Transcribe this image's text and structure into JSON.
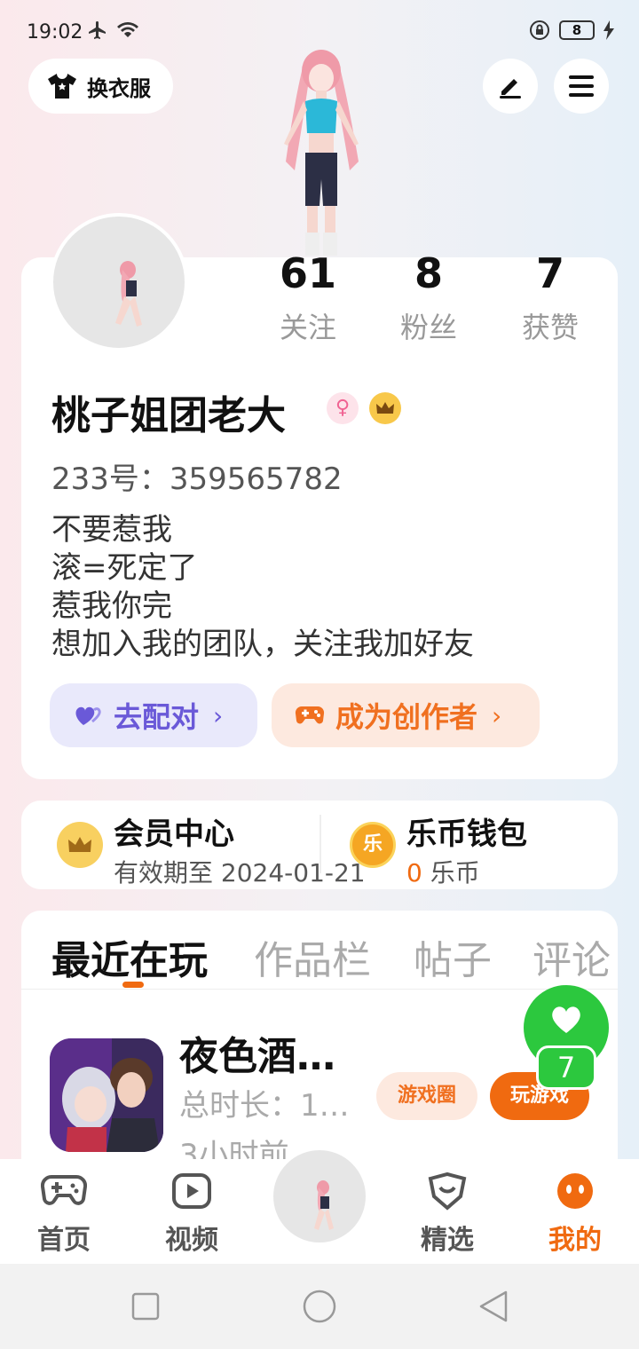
{
  "status_bar": {
    "time": "19:02",
    "battery": "8"
  },
  "header": {
    "outfit_label": "换衣服"
  },
  "stats": [
    {
      "value": "61",
      "label": "关注"
    },
    {
      "value": "8",
      "label": "粉丝"
    },
    {
      "value": "7",
      "label": "获赞"
    }
  ],
  "profile": {
    "name": "桃子姐团老大",
    "uid": "233号：359565782",
    "bio": [
      "不要惹我",
      "滚=死定了",
      "惹我你完",
      "想加入我的团队，关注我加好友"
    ],
    "match_label": "去配对",
    "creator_label": "成为创作者",
    "chevron": "›"
  },
  "member": {
    "title": "会员中心",
    "subtitle": "有效期至 2024-01-21"
  },
  "wallet": {
    "title": "乐币钱包",
    "amount": "0",
    "unit": "乐币",
    "icon_text": "乐"
  },
  "tabs": [
    "最近在玩",
    "作品栏",
    "帖子",
    "评论"
  ],
  "game": {
    "name": "夜色酒…",
    "duration": "总时长：1…",
    "last_played": "3小时前…",
    "circle_button": "游戏圈",
    "play_button": "玩游戏"
  },
  "float_like": {
    "count": "7"
  },
  "nav": [
    {
      "label": "首页"
    },
    {
      "label": "视频"
    },
    {
      "label": "精选"
    },
    {
      "label": "我的"
    }
  ],
  "colors": {
    "accent": "#f06a10",
    "purple": "#6a59d8",
    "green": "#2cc83e"
  }
}
